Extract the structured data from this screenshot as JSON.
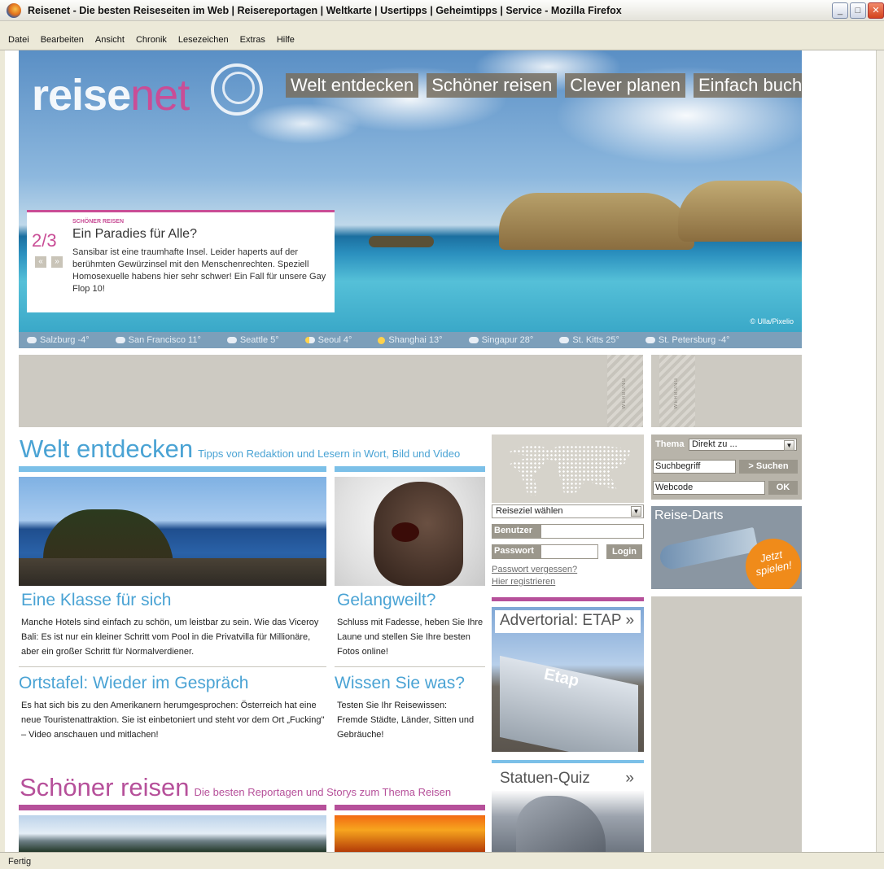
{
  "window": {
    "title": "Reisenet - Die besten Reiseseiten im Web | Reisereportagen | Weltkarte | Usertipps | Geheimtipps | Service - Mozilla Firefox",
    "minimize": "_",
    "maximize": "□",
    "close": "✕"
  },
  "menu": [
    "Datei",
    "Bearbeiten",
    "Ansicht",
    "Chronik",
    "Lesezeichen",
    "Extras",
    "Hilfe"
  ],
  "logo": {
    "part1": "reise",
    "part2": "net"
  },
  "topnav": [
    "Welt entdecken",
    "Schöner reisen",
    "Clever planen",
    "Einfach buchen"
  ],
  "teaser": {
    "kicker": "SCHÖNER REISEN",
    "counter": "2/3",
    "prev": "«",
    "next": "»",
    "title": "Ein Paradies für Alle?",
    "text": "Sansibar ist eine traumhafte Insel. Leider haperts auf der berühmten Gewürzinsel mit den Menschenrechten. Speziell Homosexuelle habens hier sehr schwer! Ein Fall für unsere Gay Flop 10!"
  },
  "photo_credit": "© Ulla/Pixelio",
  "weather": [
    {
      "label": "Salzburg -4°",
      "icon": "cloud-icon"
    },
    {
      "label": "San Francisco 11°",
      "icon": "cloud-icon"
    },
    {
      "label": "Seattle 5°",
      "icon": "cloud-icon"
    },
    {
      "label": "Seoul 4°",
      "icon": "sun-cloud-icon"
    },
    {
      "label": "Shanghai 13°",
      "icon": "sun-icon"
    },
    {
      "label": "Singapur 28°",
      "icon": "cloud-icon"
    },
    {
      "label": "St. Kitts 25°",
      "icon": "cloud-icon"
    },
    {
      "label": "St. Petersburg -4°",
      "icon": "cloud-icon"
    }
  ],
  "ads": {
    "label": "WERBUNG"
  },
  "welt": {
    "heading": "Welt entdecken",
    "subheading": "Tipps von Redaktion und Lesern in Wort, Bild und Video"
  },
  "articles": [
    {
      "title": "Eine Klasse für sich",
      "text": "Manche Hotels sind einfach zu schön, um leistbar zu sein. Wie das Viceroy Bali: Es ist nur ein kleiner Schritt vom Pool in die Privatvilla für Millionäre, aber ein großer Schritt für Normalverdiener."
    },
    {
      "title": "Gelangweilt?",
      "text": "Schluss mit Fadesse, heben Sie Ihre Laune und stellen Sie Ihre besten Fotos online!"
    },
    {
      "title": "Ortstafel: Wieder im Gespräch",
      "text": "Es hat sich bis zu den Amerikanern herumgesprochen: Österreich hat eine neue Touristenattraktion. Sie ist einbetoniert und steht vor dem Ort „Fucking\" – Video anschauen und mitlachen!"
    },
    {
      "title": "Wissen Sie was?",
      "text": "Testen Sie Ihr Reisewissen: Fremde Städte, Länder, Sitten und Gebräuche!"
    }
  ],
  "schoener": {
    "heading": "Schöner reisen",
    "subheading": "Die besten Reportagen und Storys zum Thema Reisen"
  },
  "login": {
    "reiseziel": "Reiseziel wählen",
    "benutzer_label": "Benutzer",
    "passwort_label": "Passwort",
    "login_button": "Login",
    "forgot": "Passwort vergessen?",
    "register": "Hier registrieren"
  },
  "search": {
    "thema_label": "Thema",
    "thema_value": "Direkt zu ...",
    "suchbegriff_placeholder": "Suchbegriff",
    "suchen_button": "> Suchen",
    "webcode_placeholder": "Webcode",
    "ok_button": "OK"
  },
  "darts": {
    "title": "Reise-Darts",
    "play": "Jetzt spielen!"
  },
  "advertorial": {
    "title": "Advertorial: ETAP »",
    "logo_text": "Etap"
  },
  "quiz": {
    "title": "Statuen-Quiz",
    "arrow": "»"
  },
  "status": "Fertig",
  "colors": {
    "blue": "#4aa3d4",
    "pink": "#b6509a",
    "gray": "#cdcac2"
  }
}
